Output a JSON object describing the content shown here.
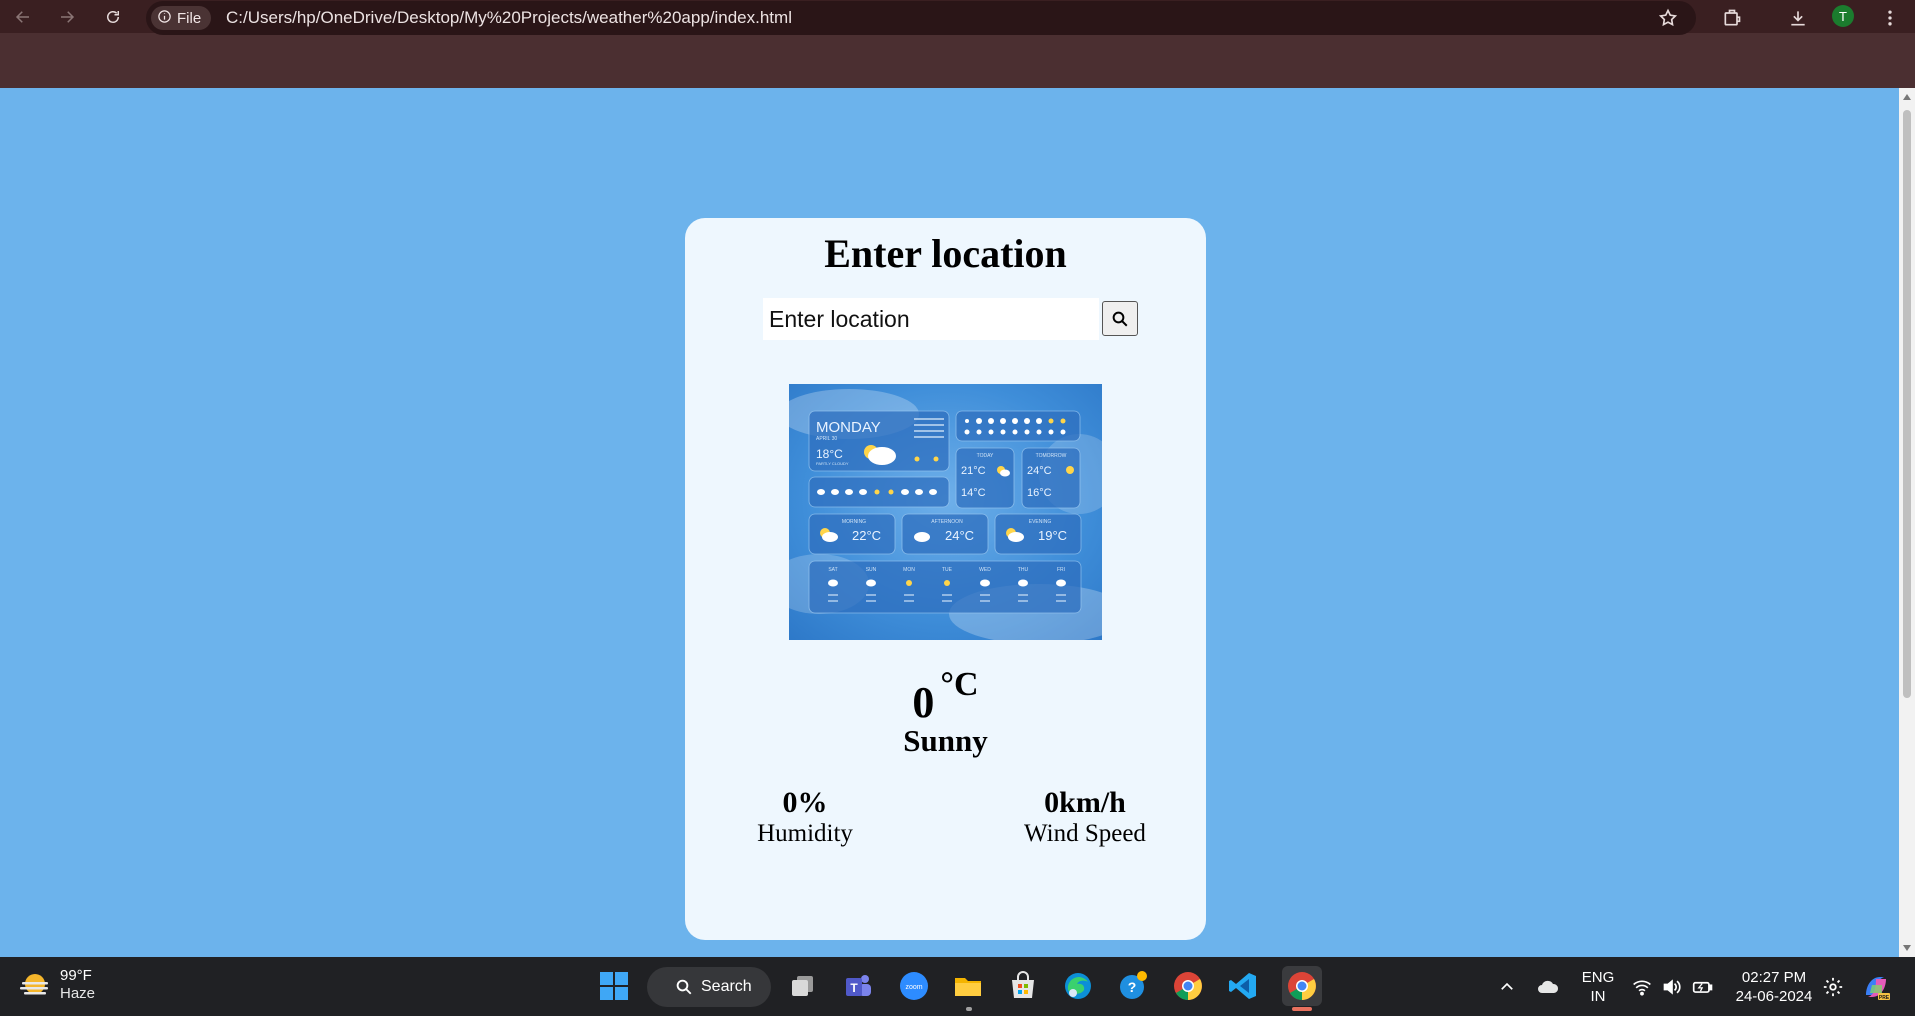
{
  "browser": {
    "file_chip_label": "File",
    "url": "C:/Users/hp/OneDrive/Desktop/My%20Projects/weather%20app/index.html",
    "avatar_initial": "T"
  },
  "app": {
    "title": "Enter location",
    "search_placeholder": "Enter location",
    "weather_image_alt": "weather forecast illustration",
    "temperature_value": "0",
    "temperature_unit": "°C",
    "condition": "Sunny",
    "humidity_value": "0%",
    "humidity_label": "Humidity",
    "wind_value": "0km/h",
    "wind_label": "Wind Speed"
  },
  "illustration": {
    "day": "MONDAY",
    "date": "APRIL 30",
    "main_temp": "18°C",
    "main_desc": "PARTLY CLOUDY",
    "today_label": "TODAY",
    "today_high": "21°C",
    "today_low": "14°C",
    "tomorrow_label": "TOMORROW",
    "tomorrow_high": "24°C",
    "tomorrow_low": "16°C",
    "morning_label": "MORNING",
    "morning_temp": "22°C",
    "afternoon_label": "AFTERNOON",
    "afternoon_temp": "24°C",
    "evening_label": "EVENING",
    "evening_temp": "19°C",
    "week_days": [
      "SAT",
      "SUN",
      "MON",
      "TUE",
      "WED",
      "THU",
      "FRI"
    ]
  },
  "taskbar": {
    "weather_temp": "99°F",
    "weather_condition": "Haze",
    "search_label": "Search",
    "language_line1": "ENG",
    "language_line2": "IN",
    "time": "02:27 PM",
    "date": "24-06-2024"
  },
  "colors": {
    "page_background": "#6cb3ec",
    "card_background": "#eef7fe",
    "browser_frame": "#4b2f31"
  }
}
